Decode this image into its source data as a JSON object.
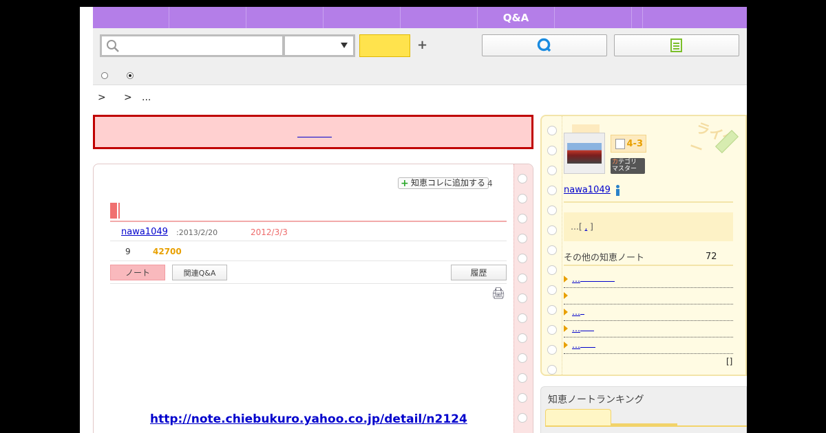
{
  "nav": {
    "items": [
      "",
      "",
      "",
      "",
      "",
      "Q&A",
      "",
      "",
      ""
    ]
  },
  "search": {
    "placeholder": "",
    "select_value": "",
    "button_label": "",
    "plus": "+"
  },
  "breadcrumb": [
    ">",
    ">",
    "..."
  ],
  "alert": {
    "link": ""
  },
  "note": {
    "add_collection": "知恵コレに追加する",
    "add_count": "4",
    "author": "nawa1049",
    "created": ":2013/2/20",
    "updated": "2012/3/3",
    "good_count": "9",
    "views": "42700",
    "tabs": {
      "note": "ノート",
      "related": "関連Q&A",
      "history": "履歴"
    },
    "url": "http://note.chiebukuro.yahoo.co.jp/detail/n2124"
  },
  "writer": {
    "label": "ライター",
    "level": "4-3",
    "master_first": "カ",
    "master_rest": "テゴリ",
    "master_line2": "マスター",
    "username": "nawa1049",
    "intro_prefix": "…[",
    "intro_link": ",",
    "intro_suffix": "]",
    "other_title": "その他の知恵ノート",
    "other_count": "72",
    "other_notes": [
      "…",
      "",
      "…",
      "…",
      "…"
    ],
    "more": "[]"
  },
  "ranking": {
    "title": "知恵ノートランキング"
  },
  "colors": {
    "nav": "#b47ee8",
    "alert_border": "#c00000",
    "accent_orange": "#e8a000",
    "link": "#0000cc"
  }
}
